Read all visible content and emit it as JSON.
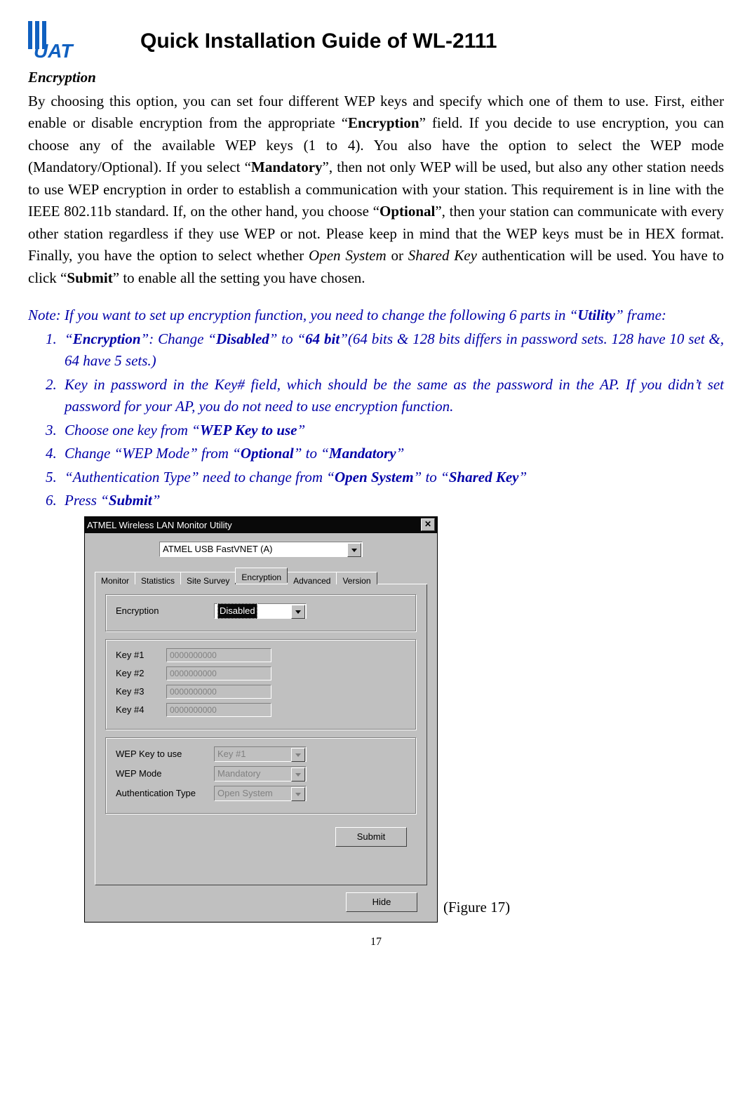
{
  "header": {
    "logo_text": "UAT",
    "title": "Quick Installation Guide of WL-2111"
  },
  "section": {
    "heading": "Encryption",
    "paragraph_parts": {
      "p1": "By choosing this option, you can set four different WEP keys and specify which one of them to use. First, either enable or disable encryption from the appropriate “",
      "b1": "Encryption",
      "p2": "” field. If you decide to use encryption, you can choose any of the available WEP keys (1 to 4). You also have the option to select the WEP mode (Mandatory/Optional). If you select “",
      "b2": "Mandatory",
      "p3": "”, then not only WEP will be used, but also any other station needs to use WEP encryption in order to establish a communication with your station. This requirement is in line with the IEEE 802.11b standard. If, on the other hand, you choose “",
      "b3": "Optional",
      "p4": "”, then your station can communicate with every other station regardless if they use WEP or not. Please keep in mind that the WEP keys must be in HEX format. Finally, you have the option to select whether ",
      "i1": "Open System",
      "p5": " or ",
      "i2": "Shared Key",
      "p6": " authentication will be used.   You have to click “",
      "b4": "Submit",
      "p7": "” to enable all the setting you have chosen."
    }
  },
  "note": {
    "intro_a": "Note: If you want to set up encryption function, you need to change the following 6 parts in “",
    "intro_b": "Utility",
    "intro_c": "” frame:",
    "items": {
      "i1a": "“",
      "i1b": "Encryption",
      "i1c": "”: Change “",
      "i1d": "Disabled",
      "i1e": "” to “",
      "i1f": "64 bit",
      "i1g": "”(64 bits & 128 bits differs in password sets. 128 have 10 set &, 64 have 5 sets.)",
      "i2": "Key in password in the Key# field, which should be the same as the password in the AP.    If you didn’t set password for your AP, you do not need to use encryption function.",
      "i3a": "Choose one key from “",
      "i3b": "WEP Key to use",
      "i3c": "”",
      "i4a": "Change “WEP Mode” from “",
      "i4b": "Optional",
      "i4c": "” to “",
      "i4d": "Mandatory",
      "i4e": "”",
      "i5a": "“Authentication Type” need to change from “",
      "i5b": "Open System",
      "i5c": "” to “",
      "i5d": "Shared Key",
      "i5e": "”",
      "i6a": "Press “",
      "i6b": "Submit",
      "i6c": "”"
    }
  },
  "dialog": {
    "title": "ATMEL Wireless LAN Monitor Utility",
    "adapter": "ATMEL USB FastVNET (A)",
    "tabs": [
      "Monitor",
      "Statistics",
      "Site Survey",
      "Encryption",
      "Advanced",
      "Version"
    ],
    "encryption_label": "Encryption",
    "encryption_value": "Disabled",
    "keys": {
      "k1_label": "Key #1",
      "k1_val": "0000000000",
      "k2_label": "Key #2",
      "k2_val": "0000000000",
      "k3_label": "Key #3",
      "k3_val": "0000000000",
      "k4_label": "Key #4",
      "k4_val": "0000000000"
    },
    "wep_key_label": "WEP Key to use",
    "wep_key_value": "Key #1",
    "wep_mode_label": "WEP Mode",
    "wep_mode_value": "Mandatory",
    "auth_label": "Authentication Type",
    "auth_value": "Open System",
    "submit": "Submit",
    "hide": "Hide"
  },
  "figure_caption": "(Figure 17)",
  "page_number": "17"
}
